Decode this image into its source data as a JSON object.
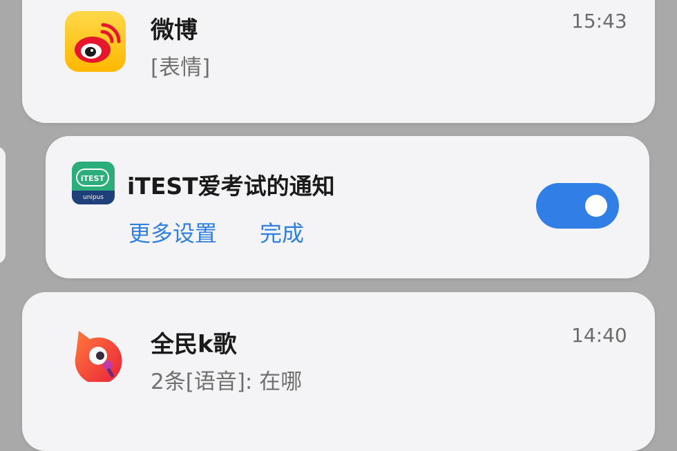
{
  "notifications": [
    {
      "app": "微博",
      "message": "[表情]",
      "time": "15:43",
      "icon": "weibo-icon"
    },
    {
      "app": "iTEST爱考试的通知",
      "icon": "itest-icon",
      "icon_text": "iTEST",
      "icon_subtext": "unipus",
      "more_settings": "更多设置",
      "done": "完成",
      "toggle_on": true
    },
    {
      "app": "全民k歌",
      "message": "2条[语音]: 在哪",
      "time": "14:40",
      "icon": "quanmin-kge-icon"
    }
  ],
  "colors": {
    "accent": "#2f7fe0",
    "toggle": "#2f7fe6",
    "card_bg": "#f4f4f6",
    "backdrop": "#a9a9a9"
  }
}
